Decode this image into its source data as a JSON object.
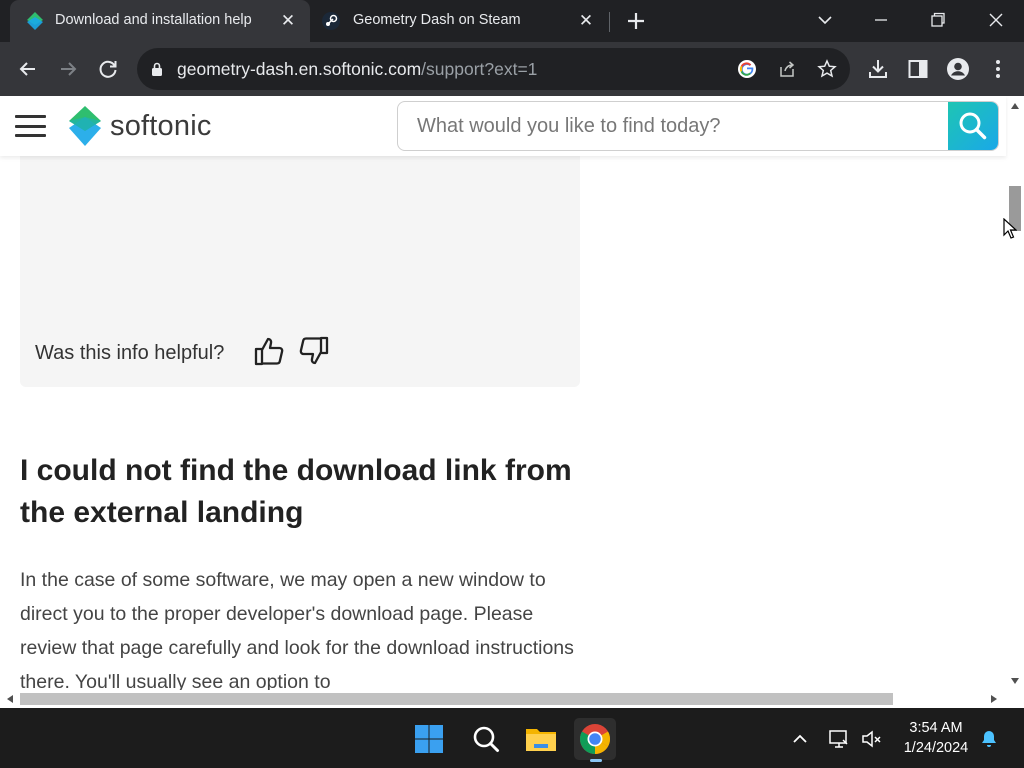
{
  "browser": {
    "tabs": [
      {
        "title": "Download and installation help",
        "active": true,
        "favicon": "softonic-icon"
      },
      {
        "title": "Geometry Dash on Steam",
        "active": false,
        "favicon": "steam-icon"
      }
    ],
    "address_bar": {
      "host": "geometry-dash.en.softonic.com",
      "path": "/support?ext=1"
    }
  },
  "site": {
    "logo_text": "softonic",
    "search_placeholder": "What would you like to find today?",
    "colors": {
      "brand_green": "#2fbe6f",
      "brand_blue": "#1aa8e8"
    }
  },
  "content": {
    "helpful_prompt": "Was this info helpful?",
    "section_title": "I could not find the download link from the external landing",
    "paragraph": "In the case of some software, we may open a new window to direct you to the proper developer's download page. Please review that page carefully and look for the download instructions there. You'll usually see an option to"
  },
  "taskbar": {
    "apps": [
      "windows-start-icon",
      "search-icon",
      "file-explorer-icon",
      "chrome-icon"
    ],
    "clock": {
      "time": "3:54 AM",
      "date": "1/24/2024"
    }
  }
}
